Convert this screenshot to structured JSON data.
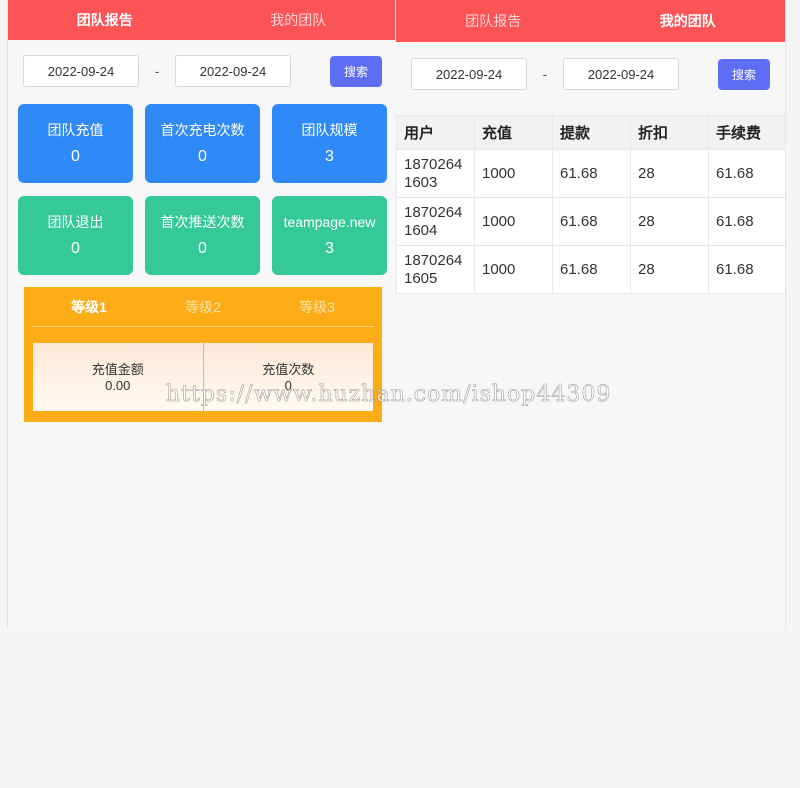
{
  "left": {
    "tabs": [
      "团队报告",
      "我的团队"
    ],
    "active_tab": 0,
    "start_date": "2022-09-24",
    "separator": "-",
    "end_date": "2022-09-24",
    "search_label": "搜索",
    "cards": [
      {
        "label": "团队充值",
        "value": "0"
      },
      {
        "label": "首次充电次数",
        "value": "0"
      },
      {
        "label": "团队规模",
        "value": "3"
      },
      {
        "label": "团队退出",
        "value": "0"
      },
      {
        "label": "首次推送次数",
        "value": "0"
      },
      {
        "label": "teampage.new",
        "value": "3"
      }
    ],
    "levels": {
      "tabs": [
        "等级1",
        "等级2",
        "等级3"
      ],
      "active": 0,
      "cells": [
        {
          "label": "充值金额",
          "value": "0.00"
        },
        {
          "label": "充值次数",
          "value": "0"
        }
      ]
    }
  },
  "right": {
    "tabs": [
      "团队报告",
      "我的团队"
    ],
    "active_tab": 1,
    "start_date": "2022-09-24",
    "separator": "-",
    "end_date": "2022-09-24",
    "search_label": "搜索",
    "table": {
      "headers": [
        "用户",
        "充值",
        "提款",
        "折扣",
        "手续费"
      ],
      "rows": [
        [
          "18702641603",
          "1000",
          "61.68",
          "28",
          "61.68"
        ],
        [
          "18702641604",
          "1000",
          "61.68",
          "28",
          "61.68"
        ],
        [
          "18702641605",
          "1000",
          "61.68",
          "28",
          "61.68"
        ]
      ]
    }
  },
  "watermark": "https://www.huzhan.com/ishop44309",
  "colors": {
    "tabbar": "#fc5356",
    "card_blue": "#2f8af7",
    "card_green": "#34c996",
    "levels_bg": "#fcac14",
    "search_button": "#5d6ef5"
  }
}
